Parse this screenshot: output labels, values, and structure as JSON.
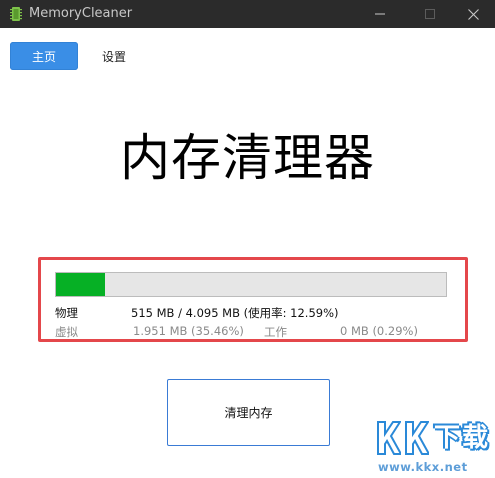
{
  "window": {
    "title": "MemoryCleaner",
    "icon": "memory-chip-icon"
  },
  "nav": {
    "tabs": [
      {
        "label": "主页",
        "active": true
      },
      {
        "label": "设置",
        "active": false
      }
    ]
  },
  "main": {
    "heading": "内存清理器"
  },
  "memory": {
    "usage_fraction": 0.1259,
    "bar_color": "#06b025",
    "highlight_color": "#e4474b",
    "physical": {
      "label": "物理",
      "value": "515 MB / 4.095 MB (使用率: 12.59%)"
    },
    "virtual": {
      "label": "虚拟",
      "value": "1.951 MB (35.46%)"
    },
    "working": {
      "label": "工作",
      "value": "0 MB (0.29%)"
    }
  },
  "actions": {
    "clean_label": "清理内存"
  },
  "watermark": {
    "logo": "KK下载",
    "url": "www.kkx.net"
  },
  "colors": {
    "accent": "#3a8ee6",
    "titlebar": "#2b2b2b"
  }
}
